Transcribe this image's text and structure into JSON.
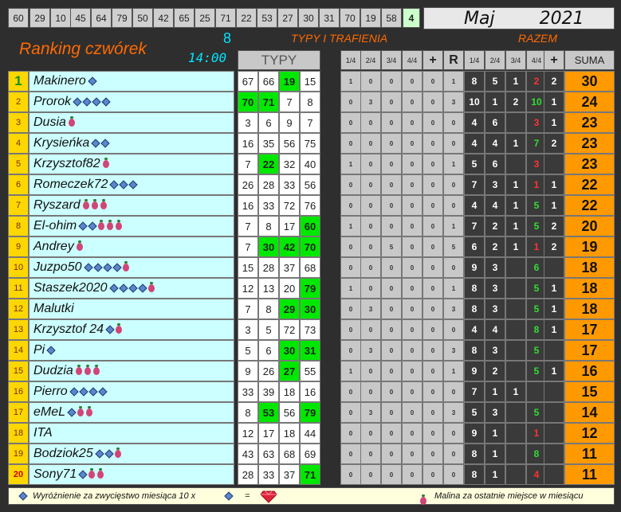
{
  "drawn_numbers": [
    "60",
    "29",
    "10",
    "45",
    "64",
    "79",
    "50",
    "42",
    "65",
    "25",
    "71",
    "22",
    "53",
    "27",
    "30",
    "31",
    "70",
    "19",
    "58",
    "4"
  ],
  "month": "Maj",
  "year": "2021",
  "title": "Ranking czwórek",
  "count": "8",
  "time": "14:00",
  "section_typy_title": "TYPY I TRAFIENIA",
  "section_razem_title": "RAZEM",
  "headers": {
    "typy": "TYPY",
    "small": [
      "1/4",
      "2/4",
      "3/4",
      "4/4",
      "+",
      "R"
    ],
    "razem": [
      "1/4",
      "2/4",
      "3/4",
      "4/4",
      "+"
    ],
    "suma": "SUMA"
  },
  "rows": [
    {
      "rank": "1",
      "name": "Makinero",
      "gems": 1,
      "berries": 0,
      "typy": [
        "67",
        "66",
        "19",
        "15"
      ],
      "hits": [
        false,
        false,
        true,
        false
      ],
      "small": [
        "1",
        "0",
        "0",
        "0",
        "0",
        "1"
      ],
      "razem": [
        "8",
        "5",
        "1",
        "2",
        "2"
      ],
      "suma": "30"
    },
    {
      "rank": "2",
      "name": "Prorok",
      "gems": 4,
      "berries": 0,
      "typy": [
        "70",
        "71",
        "7",
        "8"
      ],
      "hits": [
        true,
        true,
        false,
        false
      ],
      "small": [
        "0",
        "3",
        "0",
        "0",
        "0",
        "3"
      ],
      "razem": [
        "10",
        "1",
        "2",
        "10",
        "1"
      ],
      "suma": "24"
    },
    {
      "rank": "3",
      "name": "Dusia",
      "gems": 0,
      "berries": 1,
      "typy": [
        "3",
        "6",
        "9",
        "7"
      ],
      "hits": [
        false,
        false,
        false,
        false
      ],
      "small": [
        "0",
        "0",
        "0",
        "0",
        "0",
        "0"
      ],
      "razem": [
        "4",
        "6",
        "",
        "3",
        "1"
      ],
      "suma": "23"
    },
    {
      "rank": "4",
      "name": "Krysieńka",
      "gems": 2,
      "berries": 0,
      "typy": [
        "16",
        "35",
        "56",
        "75"
      ],
      "hits": [
        false,
        false,
        false,
        false
      ],
      "small": [
        "0",
        "0",
        "0",
        "0",
        "0",
        "0"
      ],
      "razem": [
        "4",
        "4",
        "1",
        "7",
        "2"
      ],
      "suma": "23"
    },
    {
      "rank": "5",
      "name": "Krzysztof82",
      "gems": 0,
      "berries": 1,
      "typy": [
        "7",
        "22",
        "32",
        "40"
      ],
      "hits": [
        false,
        true,
        false,
        false
      ],
      "small": [
        "1",
        "0",
        "0",
        "0",
        "0",
        "1"
      ],
      "razem": [
        "5",
        "6",
        "",
        "3",
        ""
      ],
      "suma": "23"
    },
    {
      "rank": "6",
      "name": "Romeczek72",
      "gems": 3,
      "berries": 0,
      "typy": [
        "26",
        "28",
        "33",
        "56"
      ],
      "hits": [
        false,
        false,
        false,
        false
      ],
      "small": [
        "0",
        "0",
        "0",
        "0",
        "0",
        "0"
      ],
      "razem": [
        "7",
        "3",
        "1",
        "1",
        "1"
      ],
      "suma": "22"
    },
    {
      "rank": "7",
      "name": "Ryszard",
      "gems": 0,
      "berries": 3,
      "typy": [
        "16",
        "33",
        "72",
        "76"
      ],
      "hits": [
        false,
        false,
        false,
        false
      ],
      "small": [
        "0",
        "0",
        "0",
        "0",
        "0",
        "0"
      ],
      "razem": [
        "4",
        "4",
        "1",
        "5",
        "1"
      ],
      "suma": "22"
    },
    {
      "rank": "8",
      "name": "El-ohim",
      "gems": 2,
      "berries": 3,
      "typy": [
        "7",
        "8",
        "17",
        "60"
      ],
      "hits": [
        false,
        false,
        false,
        true
      ],
      "small": [
        "1",
        "0",
        "0",
        "0",
        "0",
        "1"
      ],
      "razem": [
        "7",
        "2",
        "1",
        "5",
        "2"
      ],
      "suma": "20"
    },
    {
      "rank": "9",
      "name": "Andrey",
      "gems": 0,
      "berries": 1,
      "typy": [
        "7",
        "30",
        "42",
        "70"
      ],
      "hits": [
        false,
        true,
        true,
        true
      ],
      "small": [
        "0",
        "0",
        "5",
        "0",
        "0",
        "5"
      ],
      "razem": [
        "6",
        "2",
        "1",
        "1",
        "2"
      ],
      "suma": "19"
    },
    {
      "rank": "10",
      "name": "Juzpo50",
      "gems": 4,
      "berries": 1,
      "typy": [
        "15",
        "28",
        "37",
        "68"
      ],
      "hits": [
        false,
        false,
        false,
        false
      ],
      "small": [
        "0",
        "0",
        "0",
        "0",
        "0",
        "0"
      ],
      "razem": [
        "9",
        "3",
        "",
        "6",
        ""
      ],
      "suma": "18"
    },
    {
      "rank": "11",
      "name": "Staszek2020",
      "gems": 4,
      "berries": 1,
      "typy": [
        "12",
        "13",
        "20",
        "79"
      ],
      "hits": [
        false,
        false,
        false,
        true
      ],
      "small": [
        "1",
        "0",
        "0",
        "0",
        "0",
        "1"
      ],
      "razem": [
        "8",
        "3",
        "",
        "5",
        "1"
      ],
      "suma": "18"
    },
    {
      "rank": "12",
      "name": "Malutki",
      "gems": 0,
      "berries": 0,
      "typy": [
        "7",
        "8",
        "29",
        "30"
      ],
      "hits": [
        false,
        false,
        true,
        true
      ],
      "small": [
        "0",
        "3",
        "0",
        "0",
        "0",
        "3"
      ],
      "razem": [
        "8",
        "3",
        "",
        "5",
        "1"
      ],
      "suma": "18"
    },
    {
      "rank": "13",
      "name": "Krzysztof 24",
      "gems": 1,
      "berries": 1,
      "typy": [
        "3",
        "5",
        "72",
        "73"
      ],
      "hits": [
        false,
        false,
        false,
        false
      ],
      "small": [
        "0",
        "0",
        "0",
        "0",
        "0",
        "0"
      ],
      "razem": [
        "4",
        "4",
        "",
        "8",
        "1"
      ],
      "suma": "17"
    },
    {
      "rank": "14",
      "name": "Pi",
      "gems": 1,
      "berries": 0,
      "typy": [
        "5",
        "6",
        "30",
        "31"
      ],
      "hits": [
        false,
        false,
        true,
        true
      ],
      "small": [
        "0",
        "3",
        "0",
        "0",
        "0",
        "3"
      ],
      "razem": [
        "8",
        "3",
        "",
        "5",
        ""
      ],
      "suma": "17"
    },
    {
      "rank": "15",
      "name": "Dudzia",
      "gems": 0,
      "berries": 3,
      "typy": [
        "9",
        "26",
        "27",
        "55"
      ],
      "hits": [
        false,
        false,
        true,
        false
      ],
      "small": [
        "1",
        "0",
        "0",
        "0",
        "0",
        "1"
      ],
      "razem": [
        "9",
        "2",
        "",
        "5",
        "1"
      ],
      "suma": "16"
    },
    {
      "rank": "16",
      "name": "Pierro",
      "gems": 4,
      "berries": 0,
      "typy": [
        "33",
        "39",
        "18",
        "16"
      ],
      "hits": [
        false,
        false,
        false,
        false
      ],
      "small": [
        "0",
        "0",
        "0",
        "0",
        "0",
        "0"
      ],
      "razem": [
        "7",
        "1",
        "1",
        "",
        ""
      ],
      "suma": "15"
    },
    {
      "rank": "17",
      "name": "eMeL",
      "gems": 1,
      "berries": 2,
      "typy": [
        "8",
        "53",
        "56",
        "79"
      ],
      "hits": [
        false,
        true,
        false,
        true
      ],
      "small": [
        "0",
        "3",
        "0",
        "0",
        "0",
        "3"
      ],
      "razem": [
        "5",
        "3",
        "",
        "5",
        ""
      ],
      "suma": "14"
    },
    {
      "rank": "18",
      "name": "ITA",
      "gems": 0,
      "berries": 0,
      "typy": [
        "12",
        "17",
        "18",
        "44"
      ],
      "hits": [
        false,
        false,
        false,
        false
      ],
      "small": [
        "0",
        "0",
        "0",
        "0",
        "0",
        "0"
      ],
      "razem": [
        "9",
        "1",
        "",
        "1",
        ""
      ],
      "suma": "12"
    },
    {
      "rank": "19",
      "name": "Bodziok25",
      "gems": 2,
      "berries": 1,
      "typy": [
        "43",
        "63",
        "68",
        "69"
      ],
      "hits": [
        false,
        false,
        false,
        false
      ],
      "small": [
        "0",
        "0",
        "0",
        "0",
        "0",
        "0"
      ],
      "razem": [
        "8",
        "1",
        "",
        "8",
        ""
      ],
      "suma": "11"
    },
    {
      "rank": "20",
      "name": "Sony71",
      "gems": 1,
      "berries": 2,
      "typy": [
        "28",
        "33",
        "37",
        "71"
      ],
      "hits": [
        false,
        false,
        false,
        true
      ],
      "small": [
        "0",
        "0",
        "0",
        "0",
        "0",
        "0"
      ],
      "razem": [
        "8",
        "1",
        "",
        "4",
        ""
      ],
      "suma": "11"
    }
  ],
  "footer": {
    "left_text": "Wyróżnienie za zwycięstwo miesiąca  10 x",
    "equals": "=",
    "right_text": "Malina za ostatnie miejsce w miesiącu"
  },
  "colors": {
    "background": "#2e2e2e",
    "rank": "#ffd700",
    "name": "#ccffff",
    "hit": "#00e800",
    "suma": "#ff9900",
    "title": "#ff6a00",
    "cyan": "#00e5ff"
  }
}
